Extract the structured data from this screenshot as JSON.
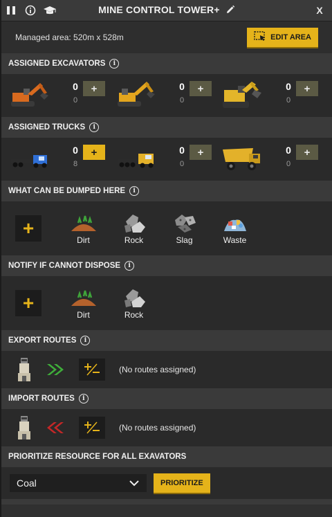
{
  "window": {
    "title": "MINE CONTROL TOWER+",
    "close_label": "X"
  },
  "managed_area": {
    "text": "Managed area: 520m x 528m",
    "edit_button": "EDIT AREA"
  },
  "excavators": {
    "header": "ASSIGNED EXCAVATORS",
    "slots": [
      {
        "icon": "excavator-orange-icon",
        "count": "0",
        "sub": "0",
        "plus": "+"
      },
      {
        "icon": "excavator-yellow-icon",
        "count": "0",
        "sub": "0",
        "plus": "+"
      },
      {
        "icon": "excavator-large-icon",
        "count": "0",
        "sub": "0",
        "plus": "+"
      }
    ]
  },
  "trucks": {
    "header": "ASSIGNED TRUCKS",
    "slots": [
      {
        "icon": "truck-blue-icon",
        "count": "0",
        "sub": "8",
        "plus": "+"
      },
      {
        "icon": "truck-yellow-icon",
        "count": "0",
        "sub": "0",
        "plus": "+"
      },
      {
        "icon": "haul-truck-icon",
        "count": "0",
        "sub": "0",
        "plus": "+"
      }
    ]
  },
  "dump": {
    "header": "WHAT CAN BE DUMPED HERE",
    "add_label": "+",
    "products": [
      {
        "icon": "dirt-icon",
        "label": "Dirt"
      },
      {
        "icon": "rock-icon",
        "label": "Rock"
      },
      {
        "icon": "slag-icon",
        "label": "Slag"
      },
      {
        "icon": "waste-icon",
        "label": "Waste"
      }
    ]
  },
  "notify": {
    "header": "NOTIFY IF CANNOT DISPOSE",
    "add_label": "+",
    "products": [
      {
        "icon": "dirt-icon",
        "label": "Dirt"
      },
      {
        "icon": "rock-icon",
        "label": "Rock"
      }
    ]
  },
  "export_routes": {
    "header": "EXPORT ROUTES",
    "status": "(No routes assigned)"
  },
  "import_routes": {
    "header": "IMPORT ROUTES",
    "status": "(No routes assigned)"
  },
  "prioritize": {
    "header": "PRIORITIZE RESOURCE FOR ALL EXAVATORS",
    "selected": "Coal",
    "button": "PRIORITIZE"
  },
  "colors": {
    "accent": "#e5b31a",
    "export_arrow": "#3fae3a",
    "import_arrow": "#c42727"
  }
}
